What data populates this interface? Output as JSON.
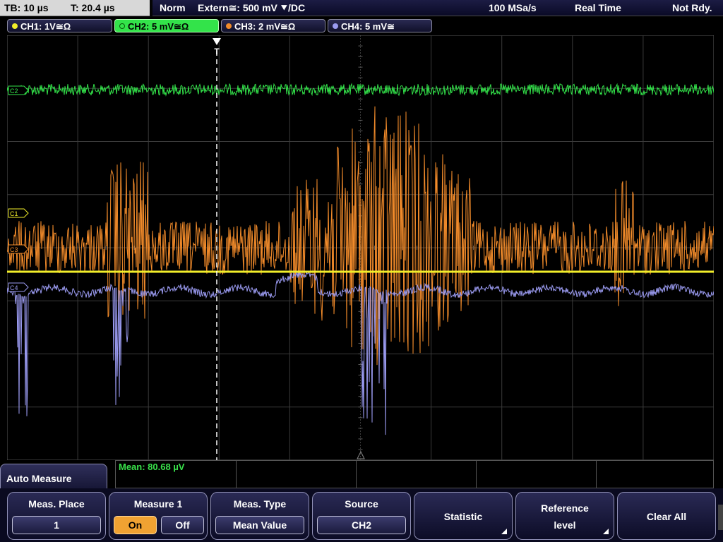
{
  "topbar": {
    "timebase": "TB: 10 µs",
    "trigger_time": "T: 20.4 µs",
    "trigger_mode": "Norm",
    "trigger_source": "Extern≅: 500 mV ⯆/DC",
    "sample_rate": "100 MSa/s",
    "acq_mode": "Real Time",
    "status": "Not Rdy."
  },
  "channels": [
    {
      "label": "CH1: 1V≅Ω",
      "color": "#f2ee2a"
    },
    {
      "label": "CH2: 5 mV≅Ω",
      "color": "#33e34a"
    },
    {
      "label": "CH3: 2 mV≅Ω",
      "color": "#f08a2a"
    },
    {
      "label": "CH4: 5 mV≅",
      "color": "#9a9af0"
    }
  ],
  "markers": {
    "c1": "C1",
    "c2": "C2",
    "c3": "C3",
    "c4": "C4",
    "trigger": "T"
  },
  "measurement": {
    "mean": "Mean: 80.68 µV"
  },
  "menu": {
    "title": "Auto Measure",
    "meas_place_label": "Meas. Place",
    "meas_place_value": "1",
    "measure1_label": "Measure 1",
    "on_label": "On",
    "off_label": "Off",
    "meas_type_label": "Meas. Type",
    "meas_type_value": "Mean Value",
    "source_label": "Source",
    "source_value": "CH2",
    "statistic_label": "Statistic",
    "ref_level_line1": "Reference",
    "ref_level_line2": "level",
    "clear_all_label": "Clear All"
  }
}
